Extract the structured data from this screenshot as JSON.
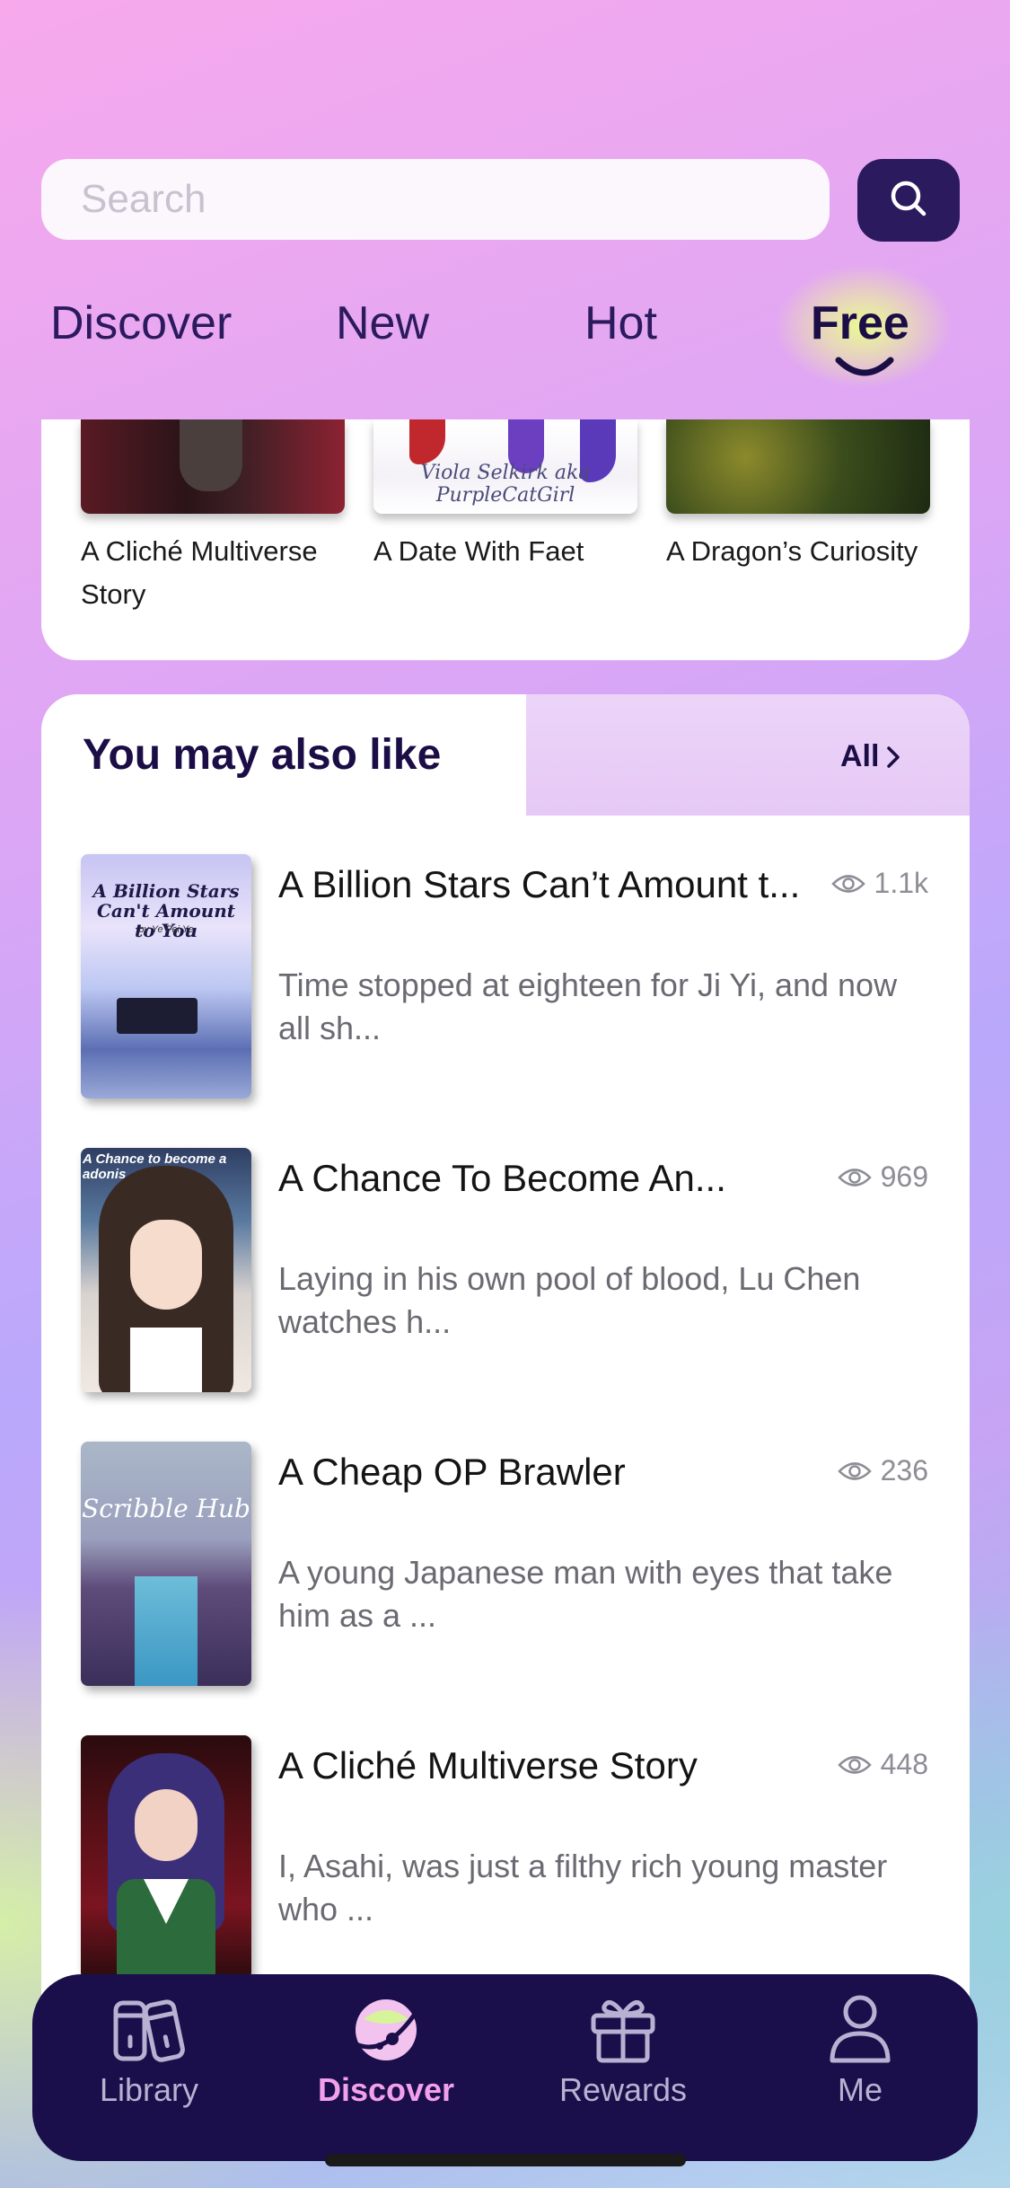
{
  "search": {
    "placeholder": "Search"
  },
  "tabs": [
    {
      "label": "Discover"
    },
    {
      "label": "New"
    },
    {
      "label": "Hot"
    },
    {
      "label": "Free",
      "active": true
    }
  ],
  "top_section": {
    "books": [
      {
        "title": "A Cliché Multiverse Story"
      },
      {
        "title": "A Date With Faet",
        "cover_text": "Viola Selkirk aka PurpleCatGirl"
      },
      {
        "title": "A Dragon’s Curiosity"
      }
    ]
  },
  "recommendations": {
    "title": "You may also like",
    "all_label": "All",
    "books": [
      {
        "title": "A Billion Stars Can’t Amount t...",
        "views": "1.1k",
        "description": "Time stopped at eighteen for Ji Yi, and now all sh...",
        "cover_title": "A Billion Stars Can't Amount to You",
        "cover_author": "by Ye Fei Ye"
      },
      {
        "title": "A Chance To Become An...",
        "views": "969",
        "description": "Laying in his own pool of blood, Lu Chen watches h...",
        "cover_title": "A Chance to become a adonis"
      },
      {
        "title": "A Cheap OP Brawler",
        "views": "236",
        "description": "A young Japanese man with eyes that take him as a ...",
        "cover_title": "Scribble Hub"
      },
      {
        "title": "A Cliché Multiverse Story",
        "views": "448",
        "description": "I, Asahi, was just a filthy rich young master who ..."
      }
    ]
  },
  "bottom_nav": [
    {
      "label": "Library",
      "icon": "books-icon"
    },
    {
      "label": "Discover",
      "icon": "planet-icon",
      "active": true
    },
    {
      "label": "Rewards",
      "icon": "gift-icon"
    },
    {
      "label": "Me",
      "icon": "person-icon"
    }
  ],
  "colors": {
    "accent_dark": "#1b0d45",
    "nav_bg": "#1a0f4a",
    "nav_active": "#f3a0ec"
  }
}
